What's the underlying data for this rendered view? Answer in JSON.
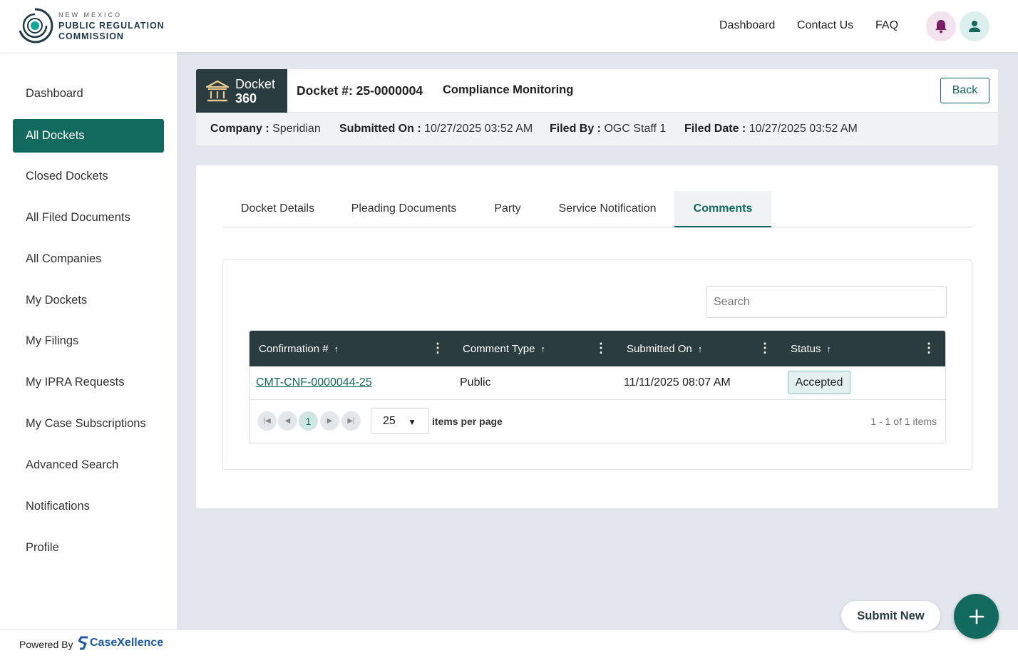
{
  "header": {
    "logo": {
      "line1": "NEW MEXICO",
      "line2": "PUBLIC REGULATION",
      "line3": "COMMISSION"
    },
    "nav": [
      "Dashboard",
      "Contact Us",
      "FAQ"
    ],
    "icons": {
      "notifications": "bell-icon",
      "profile": "user-icon"
    }
  },
  "sidebar": {
    "items": [
      {
        "label": "Dashboard",
        "active": false
      },
      {
        "label": "All Dockets",
        "active": true
      },
      {
        "label": "Closed Dockets",
        "active": false
      },
      {
        "label": "All Filed Documents",
        "active": false
      },
      {
        "label": "All Companies",
        "active": false
      },
      {
        "label": "My Dockets",
        "active": false
      },
      {
        "label": "My Filings",
        "active": false
      },
      {
        "label": "My IPRA Requests",
        "active": false
      },
      {
        "label": "My Case Subscriptions",
        "active": false
      },
      {
        "label": "Advanced Search",
        "active": false
      },
      {
        "label": "Notifications",
        "active": false
      },
      {
        "label": "Profile",
        "active": false
      }
    ]
  },
  "docket": {
    "badge_line1": "Docket",
    "badge_line2": "360",
    "number": "Docket #: 25-0000004",
    "category": "Compliance Monitoring",
    "back_label": "Back",
    "meta": {
      "company_label": "Company :",
      "company": "Speridian",
      "submitted_label": "Submitted On :",
      "submitted": "10/27/2025 03:52 AM",
      "filed_by_label": "Filed By :",
      "filed_by": "OGC Staff 1",
      "filed_date_label": "Filed Date :",
      "filed_date": "10/27/2025 03:52 AM"
    }
  },
  "tabs": [
    {
      "label": "Docket Details",
      "active": false
    },
    {
      "label": "Pleading Documents",
      "active": false
    },
    {
      "label": "Party",
      "active": false
    },
    {
      "label": "Service Notification",
      "active": false
    },
    {
      "label": "Comments",
      "active": true
    }
  ],
  "grid": {
    "search_placeholder": "Search",
    "columns": [
      "Confirmation #",
      "Comment Type",
      "Submitted On",
      "Status"
    ],
    "rows": [
      {
        "confirmation": "CMT-CNF-0000044-25",
        "type": "Public",
        "submitted": "11/11/2025 08:07 AM",
        "status": "Accepted"
      }
    ],
    "pager": {
      "current_page": "1",
      "page_size": "25",
      "items_per_page_label": "items per page",
      "count_text": "1 - 1 of 1 items"
    }
  },
  "fab": {
    "label": "Submit New"
  },
  "footer": {
    "powered_by": "Powered By",
    "brand": "CaseXellence"
  },
  "colors": {
    "primary": "#12695e",
    "dark": "#2b3c40",
    "background": "#e3e7ed"
  }
}
